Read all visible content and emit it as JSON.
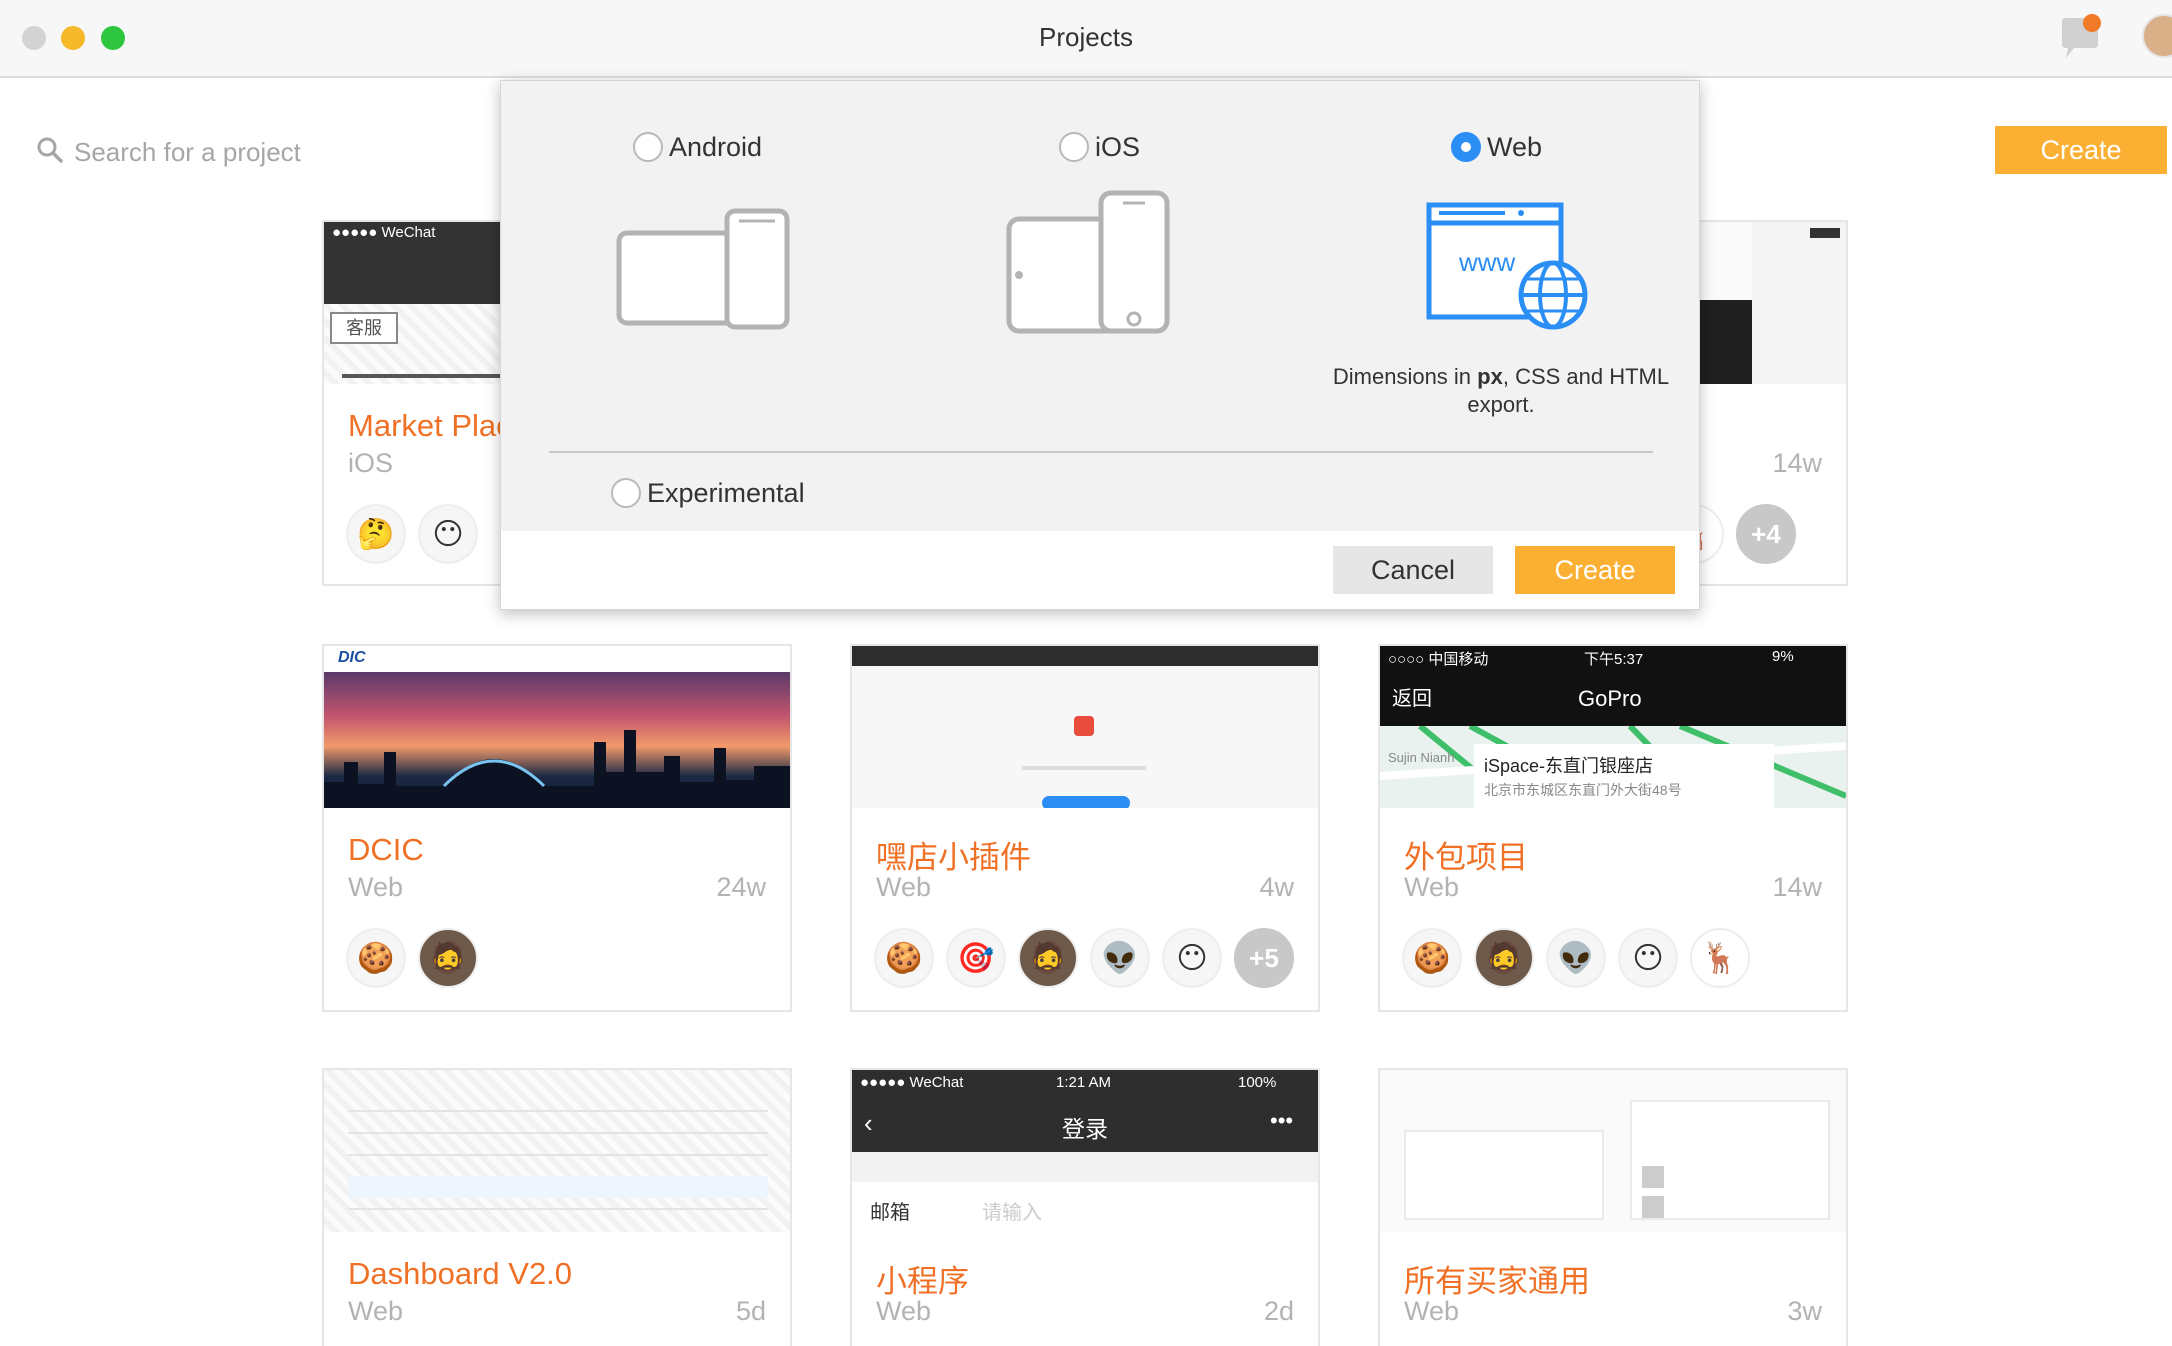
{
  "window": {
    "title": "Projects"
  },
  "search": {
    "placeholder": "Search for a project"
  },
  "toolbar": {
    "create_label": "Create"
  },
  "dialog": {
    "platforms": [
      {
        "label": "Android",
        "selected": false
      },
      {
        "label": "iOS",
        "selected": false
      },
      {
        "label": "Web",
        "selected": true
      }
    ],
    "web_desc": {
      "prefix": "Dimensions in ",
      "unit": "px",
      "suffix": ", CSS and HTML export."
    },
    "experimental_label": "Experimental",
    "cancel_label": "Cancel",
    "create_label": "Create"
  },
  "thumb_text": {
    "wechat": "●●●●● WeChat",
    "kefu": "客服",
    "dcic_logo": "DIC",
    "china_mobile": "○○○○ 中国移动",
    "time_pm": "下午5:37",
    "battery_9": "9%",
    "back": "返回",
    "gopro": "GoPro",
    "map_area": "Sujin Nianh",
    "ispace_title": "iSpace-东直门银座店",
    "ispace_addr": "北京市东城区东直门外大街48号",
    "wechat_time": "1:21 AM",
    "battery_100": "100%",
    "login": "登录",
    "email_label": "邮箱",
    "input_hint": "请输入"
  },
  "projects": [
    {
      "name": "Market Plac",
      "type": "iOS",
      "time": "",
      "members": [
        "🤔",
        "😶"
      ]
    },
    {
      "name": "",
      "type": "",
      "time": "14w",
      "members": [
        "🦌"
      ],
      "more": "+4"
    },
    {
      "name": "DCIC",
      "type": "Web",
      "time": "24w",
      "members": [
        "🍪",
        "🧔"
      ]
    },
    {
      "name": "嘿店小插件",
      "type": "Web",
      "time": "4w",
      "members": [
        "🍪",
        "🎯",
        "🧔",
        "👽",
        "😶"
      ],
      "more": "+5"
    },
    {
      "name": "外包项目",
      "type": "Web",
      "time": "14w",
      "members": [
        "🍪",
        "🧔",
        "👽",
        "😶",
        "🦌"
      ]
    },
    {
      "name": "Dashboard V2.0",
      "type": "Web",
      "time": "5d",
      "members": []
    },
    {
      "name": "小程序",
      "type": "Web",
      "time": "2d",
      "members": []
    },
    {
      "name": "所有买家通用",
      "type": "Web",
      "time": "3w",
      "members": []
    }
  ],
  "colors": {
    "accent": "#fbb034",
    "project_name": "#f07026",
    "radio_on": "#2b8ef5"
  }
}
